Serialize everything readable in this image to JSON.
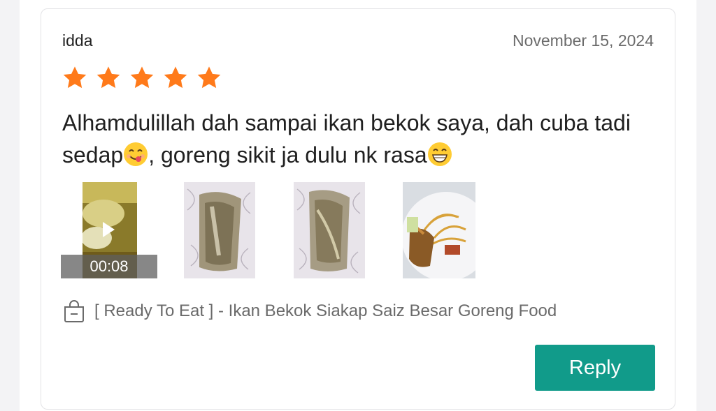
{
  "review": {
    "username": "idda",
    "date": "November 15, 2024",
    "rating": 5,
    "rating_max": 5,
    "text_part1": "Alhamdulillah dah sampai ikan bekok saya, dah cuba tadi sedap",
    "text_part2": ", goreng sikit ja dulu nk rasa",
    "emoji_1": "yum-face-emoji",
    "emoji_2": "grinning-face-emoji",
    "media": [
      {
        "type": "video",
        "duration": "00:08",
        "icon": "play-icon"
      },
      {
        "type": "image",
        "description_icon": "fish-in-bag-photo"
      },
      {
        "type": "image",
        "description_icon": "fish-in-bag-photo"
      },
      {
        "type": "image",
        "description_icon": "fried-fish-plate-photo"
      }
    ],
    "product_icon": "shopping-bag-icon",
    "product_name": "[ Ready To Eat ] - Ikan Bekok Siakap Saiz Besar Goreng Food",
    "reply_label": "Reply"
  },
  "colors": {
    "star": "#ff7a1a",
    "reply_button": "#119b8a",
    "date_text": "#6b6b6b"
  }
}
